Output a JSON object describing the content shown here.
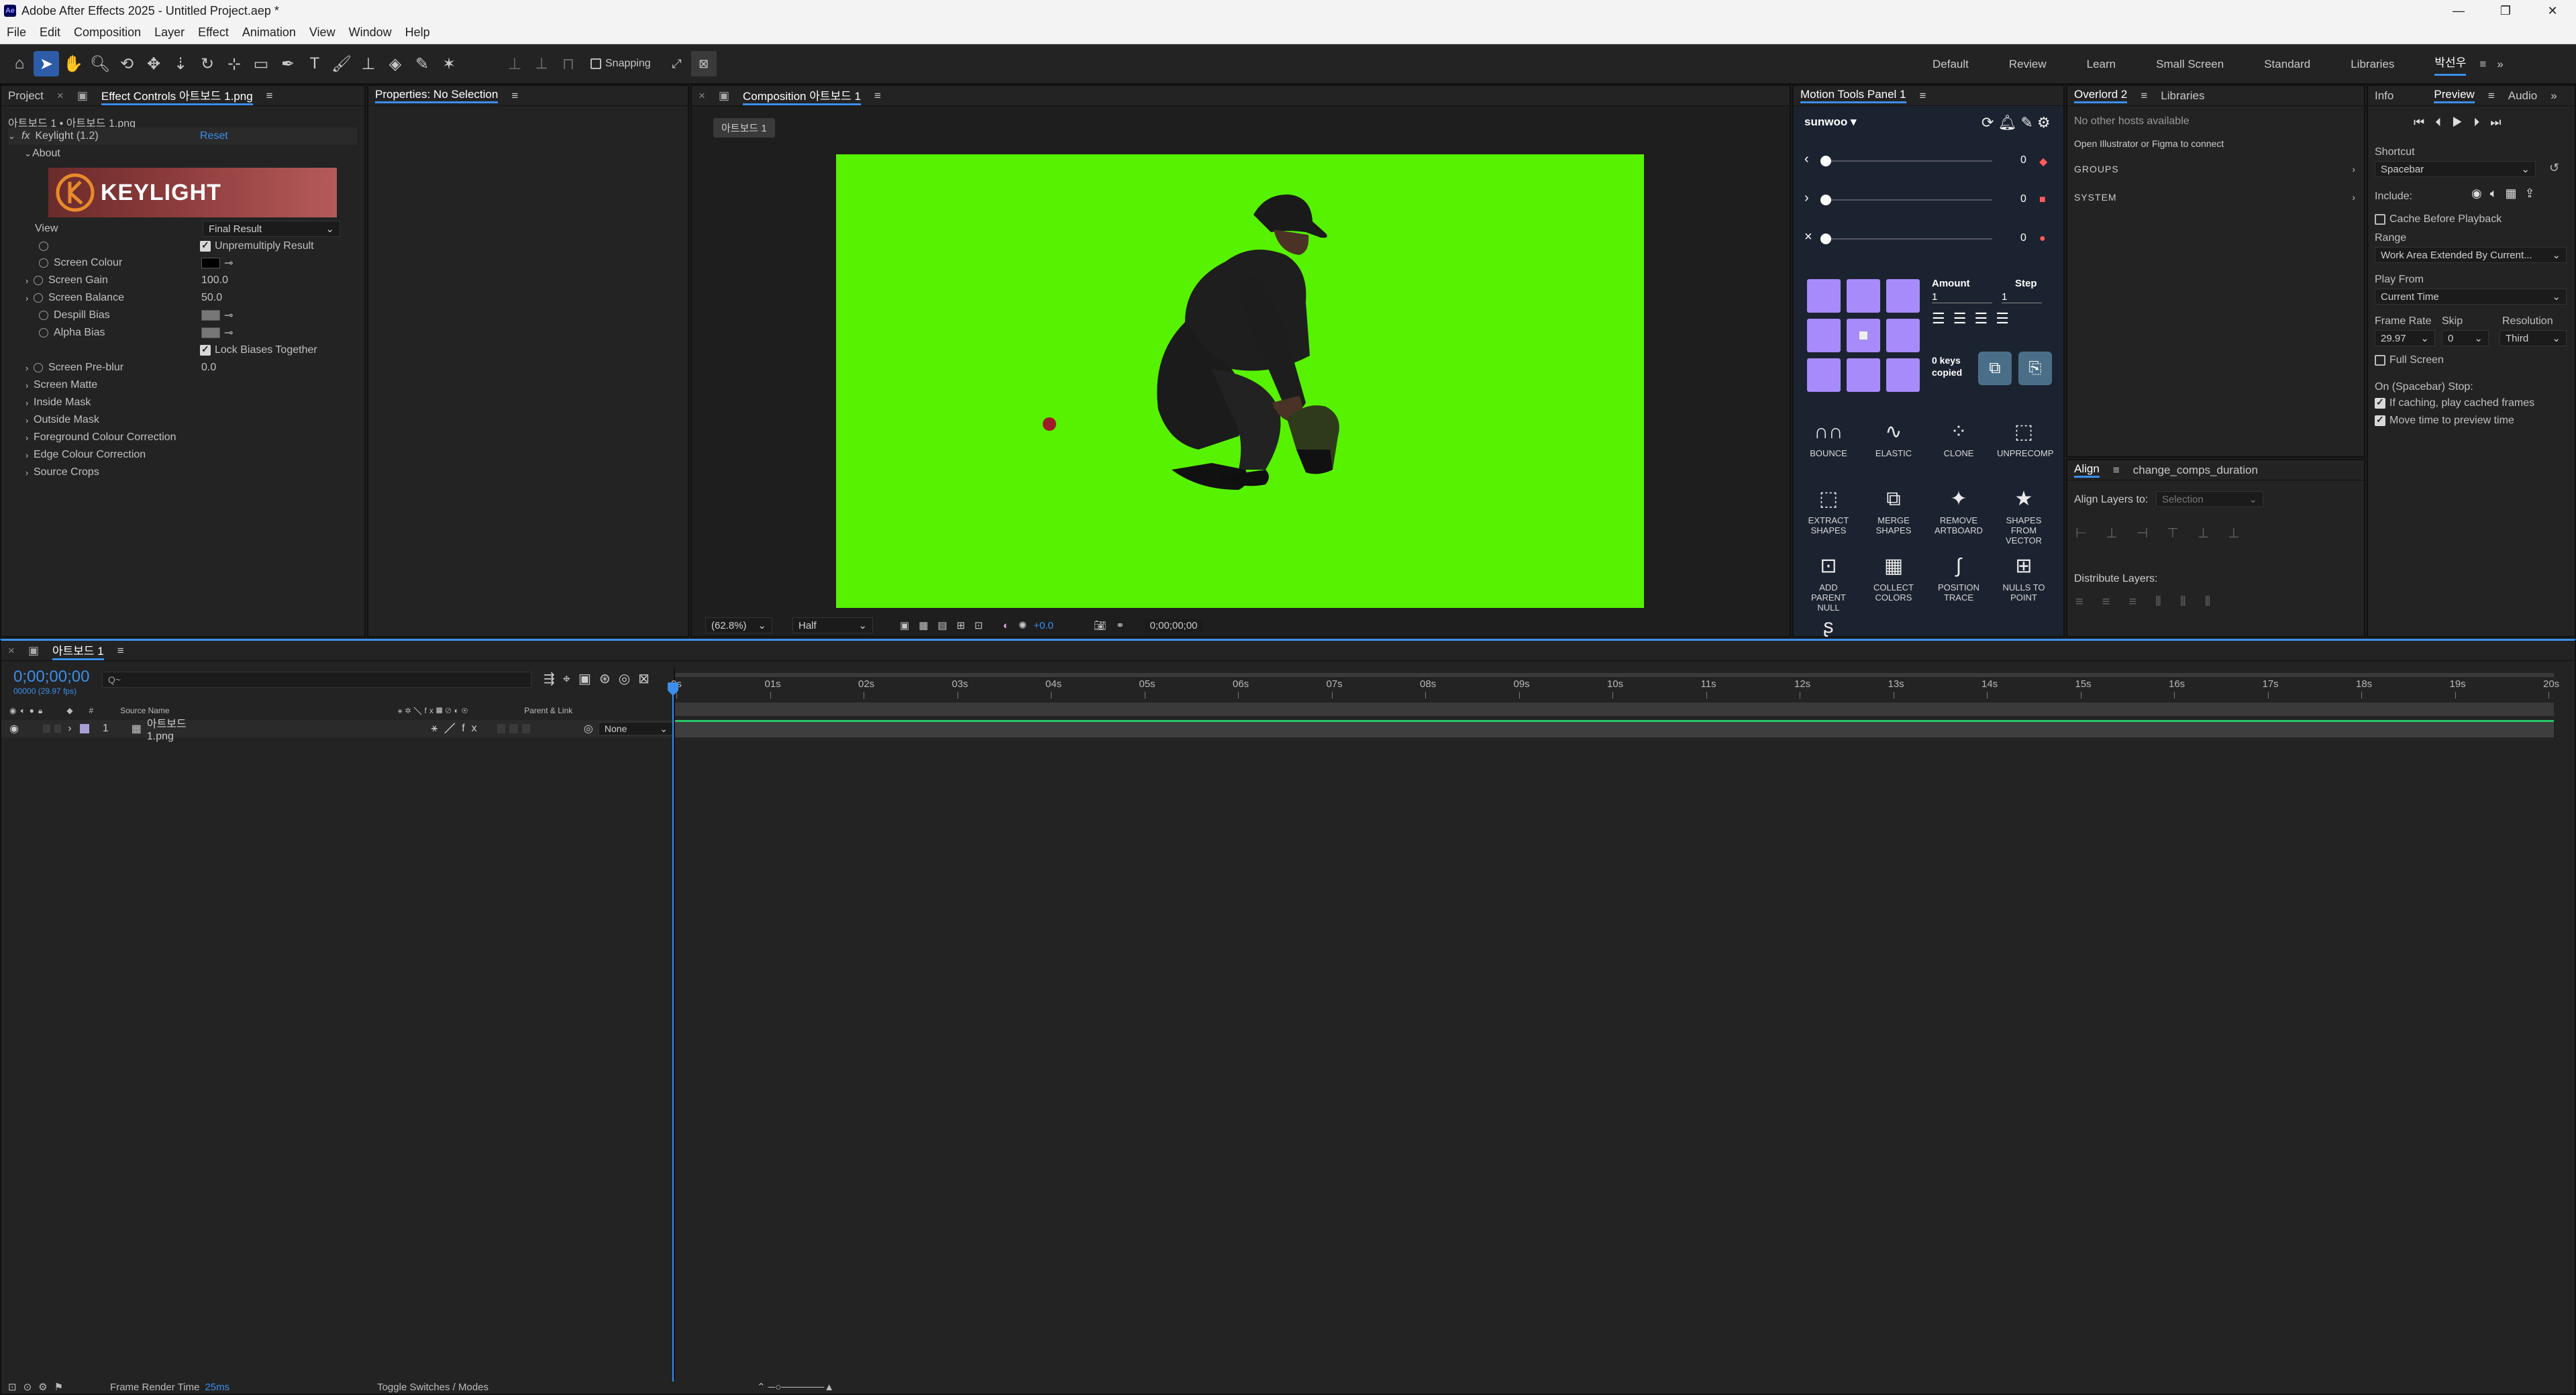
{
  "window": {
    "title": "Adobe After Effects 2025 - Untitled Project.aep *",
    "app_icon": "Ae",
    "controls": [
      "—",
      "❐",
      "✕"
    ]
  },
  "menu": [
    "File",
    "Edit",
    "Composition",
    "Layer",
    "Effect",
    "Animation",
    "View",
    "Window",
    "Help"
  ],
  "toolbar": {
    "snapping": "Snapping",
    "workspaces": [
      "Default",
      "Review",
      "Learn",
      "Small Screen",
      "Standard",
      "Libraries",
      "박선우"
    ]
  },
  "left_panel": {
    "tab_project": "Project",
    "tab_effect_controls": "Effect Controls 아트보드 1.png",
    "breadcrumb": "아트보드 1 • 아트보드 1.png",
    "effect_name": "Keylight (1.2)",
    "reset": "Reset",
    "about": "About",
    "logo": "KEYLIGHT",
    "props": [
      {
        "label": "View",
        "value": "Final Result"
      },
      {
        "label": "",
        "value": "Unpremultiply Result"
      },
      {
        "label": "Screen Colour",
        "value": ""
      },
      {
        "label": "Screen Gain",
        "value": "100.0"
      },
      {
        "label": "Screen Balance",
        "value": "50.0"
      },
      {
        "label": "Despill Bias",
        "value": ""
      },
      {
        "label": "Alpha Bias",
        "value": ""
      },
      {
        "label": "",
        "value": "Lock Biases Together"
      },
      {
        "label": "Screen Pre-blur",
        "value": "0.0"
      },
      {
        "label": "Screen Matte",
        "value": ""
      },
      {
        "label": "Inside Mask",
        "value": ""
      },
      {
        "label": "Outside Mask",
        "value": ""
      },
      {
        "label": "Foreground Colour Correction",
        "value": ""
      },
      {
        "label": "Edge Colour Correction",
        "value": ""
      },
      {
        "label": "Source Crops",
        "value": ""
      }
    ]
  },
  "properties_panel": {
    "title": "Properties: No Selection"
  },
  "composition": {
    "tab": "Composition 아트보드 1",
    "flowchart_tab": "아트보드 1",
    "zoom": "(62.8%)",
    "resolution": "Half",
    "exposure": "+0.0",
    "timecode": "0;00;00;00",
    "bg_color": "#57f200"
  },
  "motion_tools": {
    "tab": "Motion Tools Panel 1",
    "user": "sunwoo",
    "slider_values": [
      "0",
      "0",
      "0"
    ],
    "amount_label": "Amount",
    "step_label": "Step",
    "amount": "1",
    "step": "1",
    "keys_copied": "0 keys copied",
    "buttons": [
      "BOUNCE",
      "ELASTIC",
      "CLONE",
      "UNPRECOMP",
      "EXTRACT SHAPES",
      "MERGE SHAPES",
      "REMOVE ARTBOARD",
      "SHAPES FROM VECTOR",
      "ADD PARENT NULL",
      "COLLECT COLORS",
      "POSITION TRACE",
      "NULLS TO POINT"
    ]
  },
  "overlord": {
    "tab": "Overlord 2",
    "tab2": "Libraries",
    "status": "No other hosts available",
    "connect": "Open Illustrator or Figma to connect",
    "groups": "GROUPS",
    "system": "SYSTEM"
  },
  "align": {
    "tab": "Align",
    "tab2": "change_comps_duration",
    "align_to_label": "Align Layers to:",
    "align_to_value": "Selection",
    "distribute_label": "Distribute Layers:"
  },
  "preview": {
    "tab_info": "Info",
    "tab_preview": "Preview",
    "tab_audio": "Audio",
    "shortcut_label": "Shortcut",
    "shortcut": "Spacebar",
    "include_label": "Include:",
    "cache": "Cache Before Playback",
    "range_label": "Range",
    "range": "Work Area Extended By Current...",
    "play_from_label": "Play From",
    "play_from": "Current Time",
    "frame_rate_label": "Frame Rate",
    "skip_label": "Skip",
    "resolution_label": "Resolution",
    "frame_rate": "29.97",
    "skip": "0",
    "resolution": "Third",
    "full_screen": "Full Screen",
    "on_stop_label": "On (Spacebar) Stop:",
    "if_caching": "If caching, play cached frames",
    "move_time": "Move time to preview time"
  },
  "timeline": {
    "tab": "아트보드 1",
    "timecode": "0;00;00;00",
    "fps": "00000 (29.97 fps)",
    "search_placeholder": "Q~",
    "col_source": "Source Name",
    "col_parent": "Parent & Link",
    "layer_num": "1",
    "layer_name": "아트보드 1.png",
    "parent_value": "None",
    "ticks": [
      "0s",
      "01s",
      "02s",
      "03s",
      "04s",
      "05s",
      "06s",
      "07s",
      "08s",
      "09s",
      "10s",
      "11s",
      "12s",
      "13s",
      "14s",
      "15s",
      "16s",
      "17s",
      "18s",
      "19s",
      "20s"
    ],
    "footer_render_label": "Frame Render Time",
    "footer_render_value": "25ms",
    "footer_toggle": "Toggle Switches / Modes"
  }
}
